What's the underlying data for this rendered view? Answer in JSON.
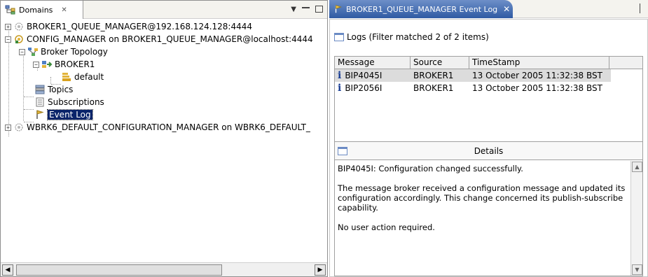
{
  "domains_view": {
    "tab_label": "Domains",
    "tree": [
      {
        "label": "BROKER1_QUEUE_MANAGER@192.168.124.128:4444",
        "toggle": "+"
      },
      {
        "label": "CONFIG_MANAGER on BROKER1_QUEUE_MANAGER@localhost:4444",
        "toggle": "−"
      },
      {
        "label": "Broker Topology",
        "toggle": "−"
      },
      {
        "label": "BROKER1",
        "toggle": "−"
      },
      {
        "label": "default"
      },
      {
        "label": "Topics"
      },
      {
        "label": "Subscriptions"
      },
      {
        "label": "Event Log",
        "selected": true
      },
      {
        "label": "WBRK6_DEFAULT_CONFIGURATION_MANAGER on WBRK6_DEFAULT_",
        "toggle": "+"
      }
    ]
  },
  "editor": {
    "tab_label": "BROKER1_QUEUE_MANAGER Event Log",
    "logs_label": "Logs (Filter matched 2 of 2 items)",
    "columns": [
      "Message",
      "Source",
      "TimeStamp"
    ],
    "rows": [
      {
        "message": "BIP4045I",
        "source": "BROKER1",
        "timestamp": "13 October 2005 11:32:38 BST",
        "selected": true
      },
      {
        "message": "BIP2056I",
        "source": "BROKER1",
        "timestamp": "13 October 2005 11:32:38 BST"
      }
    ],
    "details_title": "Details",
    "details_line1": "BIP4045I: Configuration changed successfully.",
    "details_line2": "The message broker received a configuration message and updated its configuration accordingly.  This change concerned its publish-subscribe capability.",
    "details_line3": "No user action required."
  }
}
